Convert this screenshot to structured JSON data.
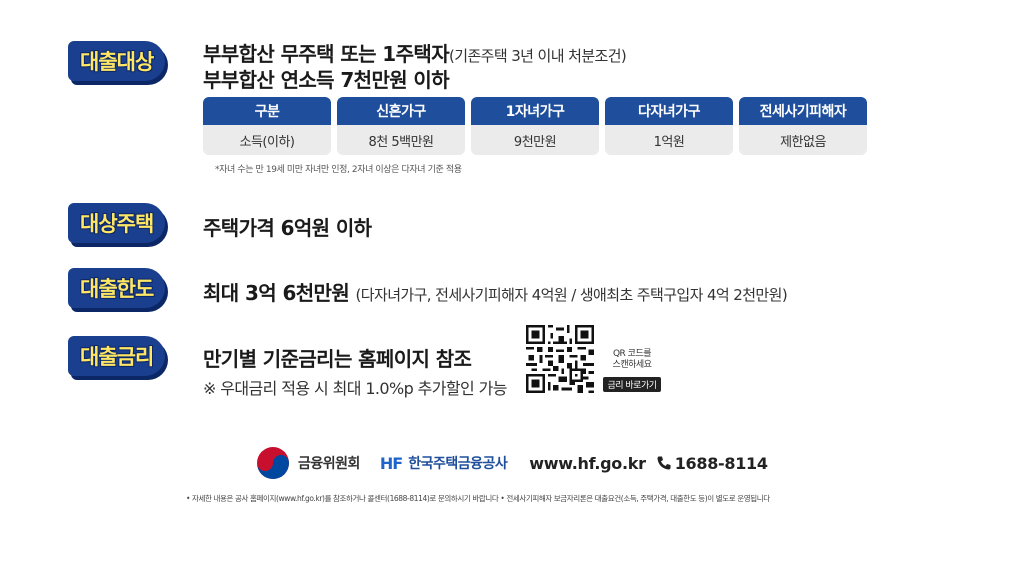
{
  "sections": {
    "eligibility": {
      "badge": "대출대상",
      "line1_main": "부부합산 무주택 또는 1주택자",
      "line1_sub": "(기존주택 3년 이내 처분조건)",
      "line2": "부부합산 연소득 7천만원 이하"
    },
    "housing": {
      "badge": "대상주택",
      "text": "주택가격 6억원 이하"
    },
    "limit": {
      "badge": "대출한도",
      "main": "최대 3억 6천만원",
      "sub": "(다자녀가구, 전세사기피해자 4억원 / 생애최초 주택구입자 4억 2천만원)"
    },
    "rate": {
      "badge": "대출금리",
      "main": "만기별 기준금리는 홈페이지 참조",
      "sub": "※ 우대금리 적용 시 최대 1.0%p 추가할인 가능"
    }
  },
  "income_table": {
    "columns": [
      {
        "header": "구분",
        "value": "소득(이하)"
      },
      {
        "header": "신혼가구",
        "value": "8천 5백만원"
      },
      {
        "header": "1자녀가구",
        "value": "9천만원"
      },
      {
        "header": "다자녀가구",
        "value": "1억원"
      },
      {
        "header": "전세사기피해자",
        "value": "제한없음"
      }
    ],
    "note": "*자녀 수는 만 19세 미만 자녀만 인정, 2자녀 이상은 다자녀 기준 적용"
  },
  "qr": {
    "line1": "QR 코드를",
    "line2": "스캔하세요",
    "button": "금리 바로가기"
  },
  "footer": {
    "fsc_name": "금융위원회",
    "hf_logo": "HF",
    "hf_name": "한국주택금융공사",
    "url": "www.hf.go.kr",
    "phone": "1688-8114",
    "disclaimer": "• 자세한 내용은 공사 홈페이지(www.hf.go.kr)를 참조하거나 콜센터(1688-8114)로 문의하시기 바랍니다  • 전세사기피해자 보금자리론은 대출요건(소득, 주택가격, 대출한도 등)이 별도로 운영됩니다"
  },
  "colors": {
    "badge_bg": "#1b3f8f",
    "badge_text": "#ffe766",
    "table_header": "#1f4f9c",
    "table_cell": "#ebebeb",
    "brand_blue": "#1f64c8"
  }
}
